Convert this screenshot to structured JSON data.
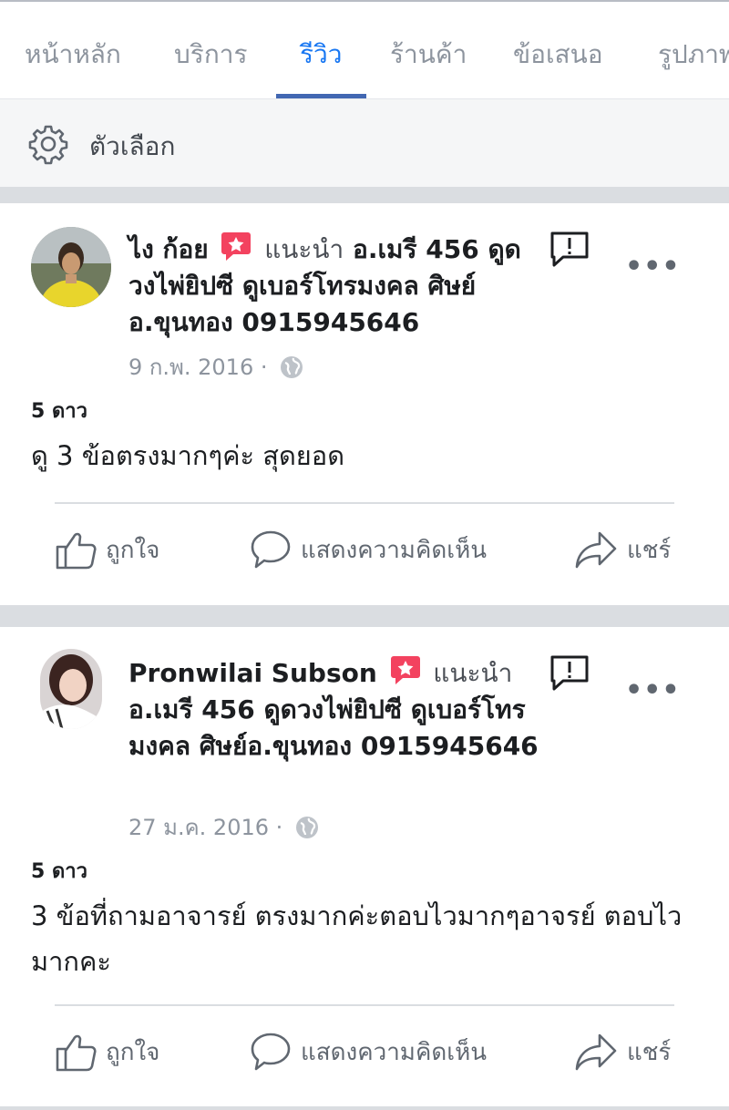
{
  "tabs": [
    {
      "label": "หน้าหลัก"
    },
    {
      "label": "บริการ"
    },
    {
      "label": "รีวิว",
      "active": true
    },
    {
      "label": "ร้านค้า"
    },
    {
      "label": "ข้อเสนอ"
    },
    {
      "label": "รูปภาพ"
    }
  ],
  "options": {
    "label": "ตัวเลือก",
    "icon": "gear-icon"
  },
  "colors": {
    "accent": "#1877f2",
    "tab_underline": "#4267b2",
    "badge": "#f3425f",
    "separator": "#dadde1"
  },
  "reviews": [
    {
      "reviewer": "ไง ก้อย",
      "recommends": "แนะนำ",
      "page_name": "อ.เมรี 456 ดูดวงไพ่ยิปซี ดูเบอร์โทรมงคล ศิษย์อ.ขุนทอง 0915945646",
      "date": "9 ก.พ. 2016",
      "dot": "·",
      "rating": "5 ดาว",
      "text": "ดู 3 ข้อตรงมากๆค่ะ สุดยอด"
    },
    {
      "reviewer": "Pronwilai Subson",
      "recommends": "แนะนำ",
      "page_name": "อ.เมรี 456 ดูดวงไพ่ยิปซี ดูเบอร์โทรมงคล ศิษย์อ.ขุนทอง 0915945646",
      "date": "27 ม.ค. 2016",
      "dot": "·",
      "rating": "5 ดาว",
      "text": "3 ข้อที่ถามอาจารย์ ตรงมากค่ะตอบไวมากๆอาจรย์ ตอบไวมากคะ"
    }
  ],
  "actions": {
    "like": "ถูกใจ",
    "comment": "แสดงความคิดเห็น",
    "share": "แชร์"
  },
  "more_label": "•••"
}
